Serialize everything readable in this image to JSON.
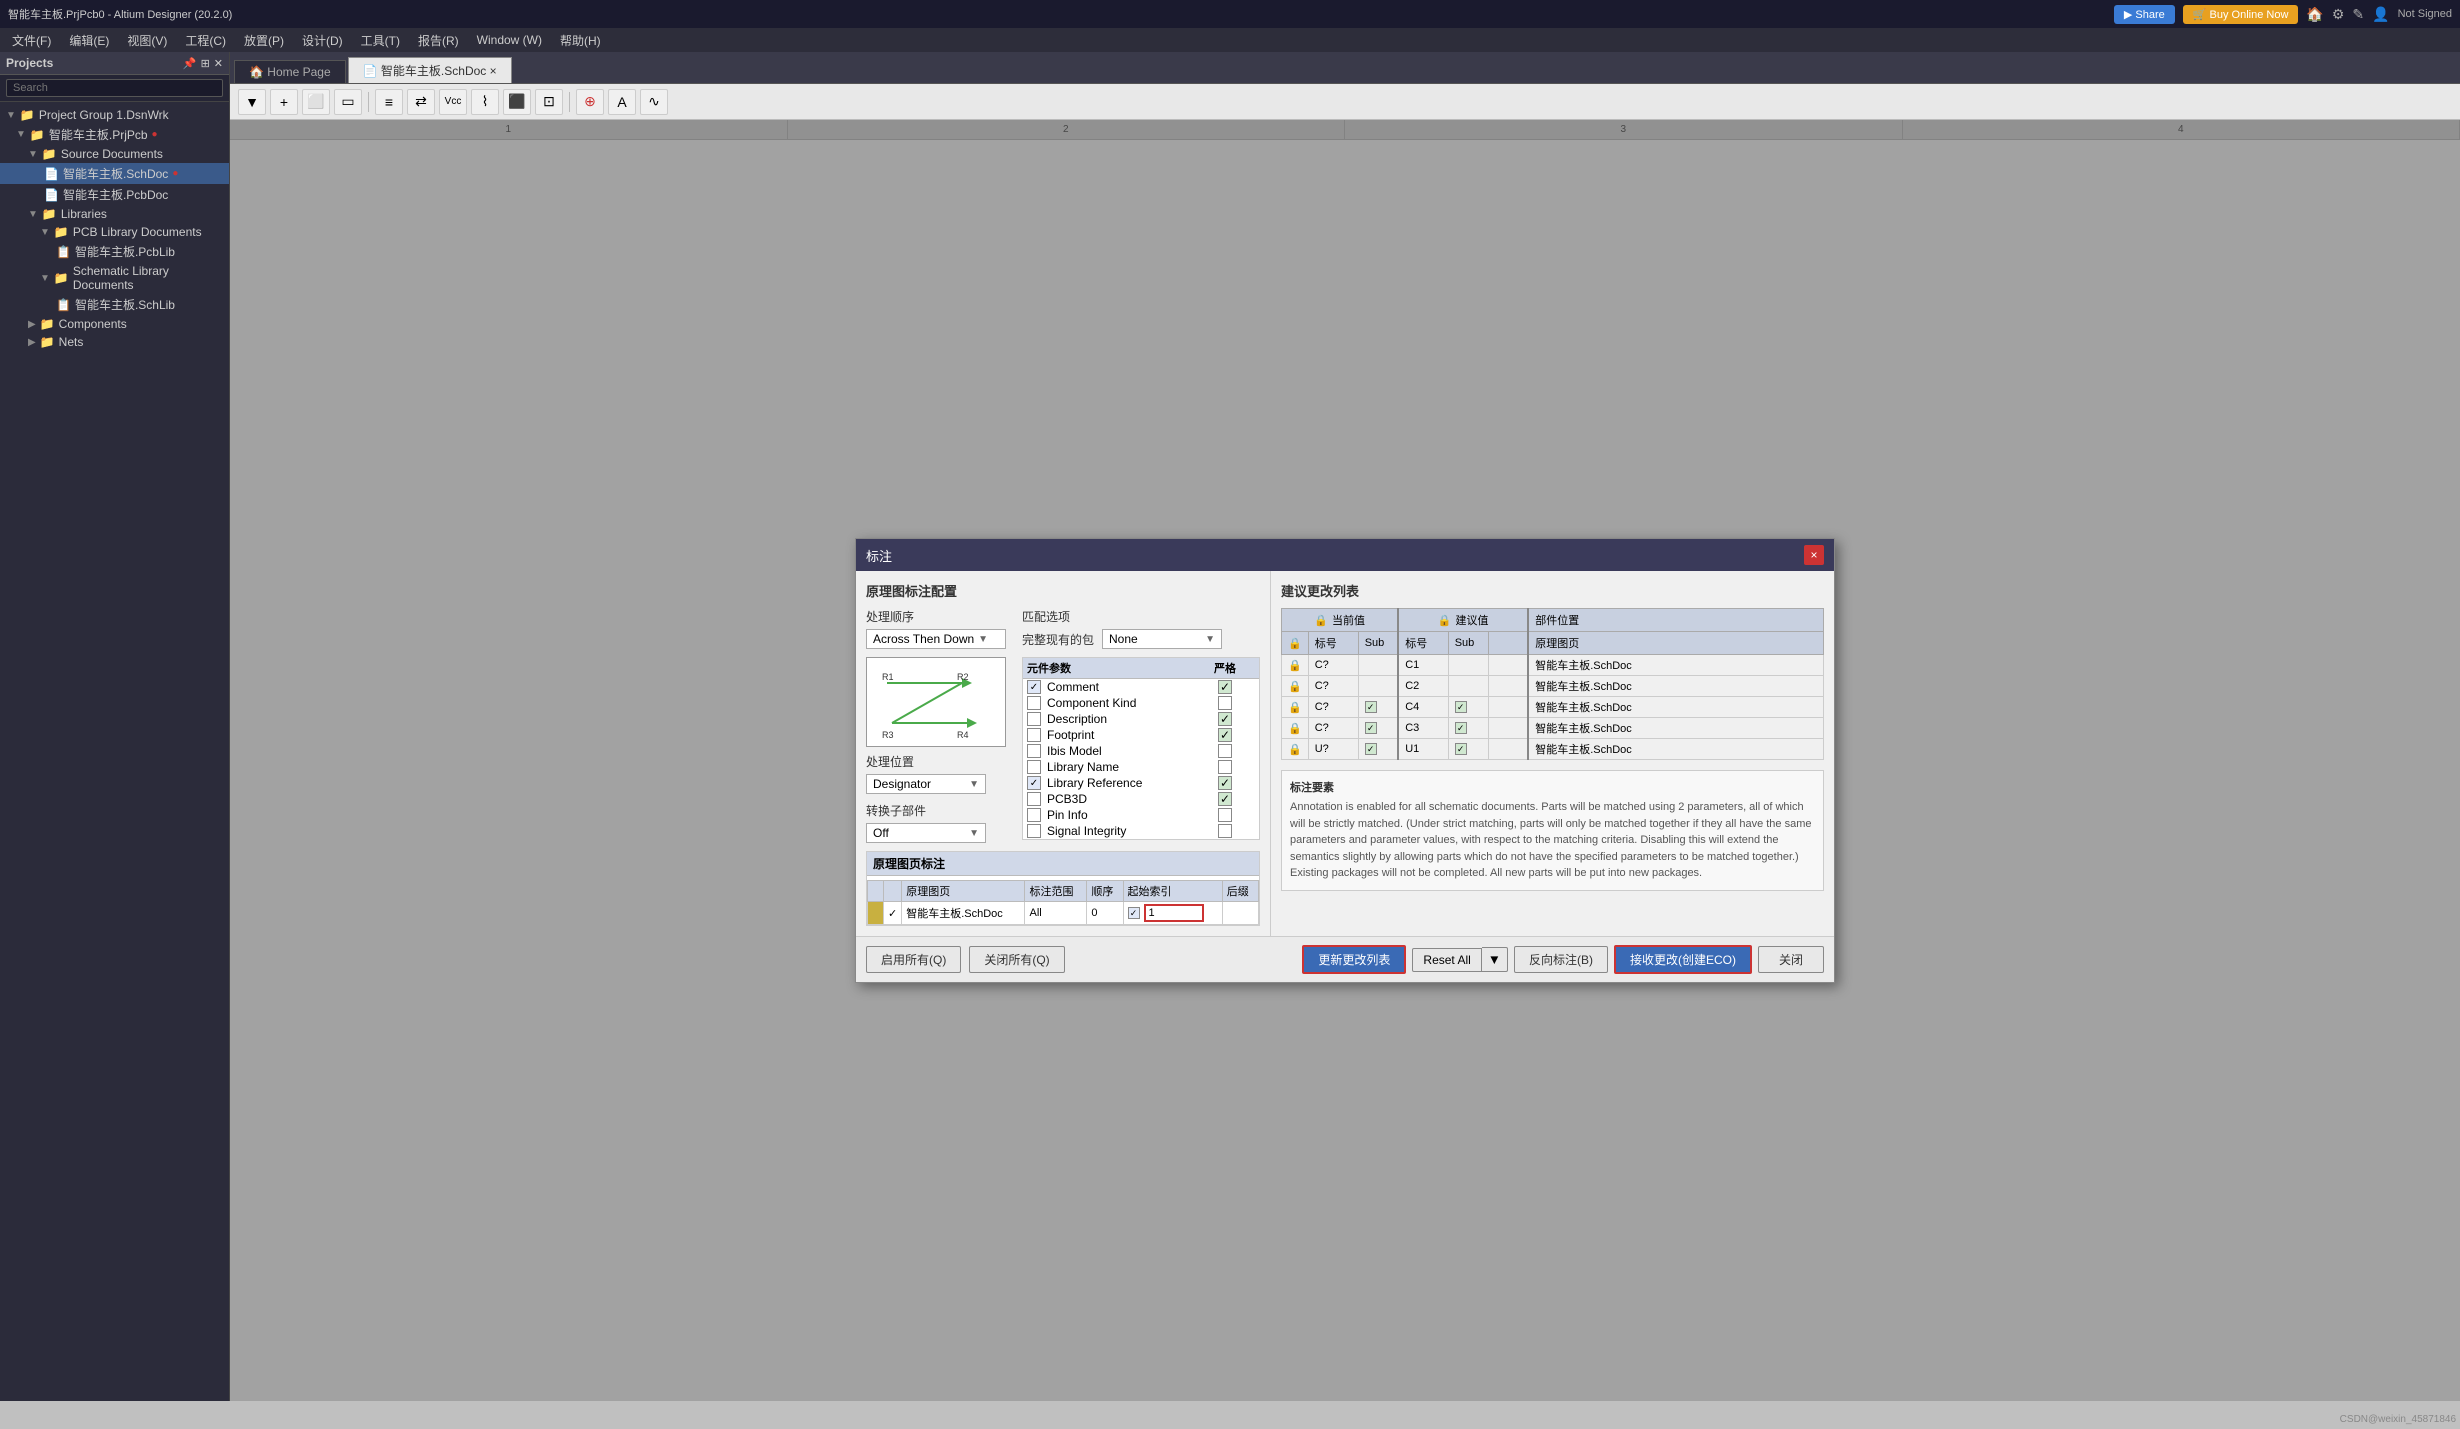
{
  "app": {
    "title": "智能车主板.PrjPcb0 - Altium Designer (20.2.0)",
    "menu_items": [
      "文件(F)",
      "编辑(E)",
      "视图(V)",
      "工程(C)",
      "放置(P)",
      "设计(D)",
      "工具(T)",
      "报告(R)",
      "Window (W)",
      "帮助(H)"
    ]
  },
  "topbar": {
    "share_label": "Share",
    "buy_label": "Buy Online Now",
    "not_signed": "Not Signed"
  },
  "tabs": [
    {
      "label": "Home Page",
      "active": false
    },
    {
      "label": "智能车主板.SchDoc",
      "active": true
    }
  ],
  "sidebar": {
    "title": "Projects",
    "search_placeholder": "Search",
    "tree": [
      {
        "label": "Project Group 1.DsnWrk",
        "level": 0,
        "type": "project-group"
      },
      {
        "label": "智能车主板.PrjPcb",
        "level": 0,
        "type": "project",
        "active": true
      },
      {
        "label": "Source Documents",
        "level": 1,
        "type": "folder"
      },
      {
        "label": "智能车主板.SchDoc",
        "level": 2,
        "type": "doc",
        "selected": true
      },
      {
        "label": "智能车主板.PcbDoc",
        "level": 2,
        "type": "doc"
      },
      {
        "label": "Libraries",
        "level": 1,
        "type": "folder"
      },
      {
        "label": "PCB Library Documents",
        "level": 2,
        "type": "folder"
      },
      {
        "label": "智能车主板.PcbLib",
        "level": 3,
        "type": "lib"
      },
      {
        "label": "Schematic Library Documents",
        "level": 2,
        "type": "folder"
      },
      {
        "label": "智能车主板.SchLib",
        "level": 3,
        "type": "lib"
      },
      {
        "label": "Components",
        "level": 1,
        "type": "folder"
      },
      {
        "label": "Nets",
        "level": 1,
        "type": "folder"
      }
    ]
  },
  "ruler": {
    "marks": [
      "1",
      "2",
      "3",
      "4"
    ]
  },
  "dialog": {
    "title": "标注",
    "close_label": "×",
    "left_panel": {
      "main_title": "原理图标注配置",
      "processing_order_title": "处理顺序",
      "processing_order_value": "Across Then Down",
      "processing_position_title": "处理位置",
      "processing_position_value": "Designator",
      "sub_parts_title": "转换子部件",
      "sub_parts_value": "Off",
      "matching_title": "匹配选项",
      "complete_packages_label": "完整现有的包",
      "complete_packages_value": "None",
      "params_header_name": "元件参数",
      "params_header_strict": "严格",
      "params": [
        {
          "name": "Comment",
          "checked": true,
          "strict": true
        },
        {
          "name": "Component Kind",
          "checked": false,
          "strict": false
        },
        {
          "name": "Description",
          "checked": false,
          "strict": true
        },
        {
          "name": "Footprint",
          "checked": false,
          "strict": true
        },
        {
          "name": "Ibis Model",
          "checked": false,
          "strict": false
        },
        {
          "name": "Library Name",
          "checked": false,
          "strict": false
        },
        {
          "name": "Library Reference",
          "checked": true,
          "strict": true
        },
        {
          "name": "PCB3D",
          "checked": false,
          "strict": true
        },
        {
          "name": "Pin Info",
          "checked": false,
          "strict": false
        },
        {
          "name": "Signal Integrity",
          "checked": false,
          "strict": false
        }
      ],
      "annot_table_title": "原理图页标注",
      "annot_columns": [
        "原理图页",
        "标注范围",
        "顺序",
        "起始索引",
        "后缀"
      ],
      "annot_rows": [
        {
          "enabled": true,
          "name": "智能车主板.SchDoc",
          "range": "All",
          "order": "0",
          "start_index": "1",
          "suffix": ""
        }
      ]
    },
    "right_panel": {
      "suggest_title": "建议更改列表",
      "current_col": "当前值",
      "suggest_col": "建议值",
      "part_location_col": "部件位置",
      "columns": {
        "lock": "🔒",
        "designator": "标号",
        "sub": "Sub",
        "suggest_designator": "标号",
        "suggest_sub": "Sub",
        "origin_sheet": "原理图页"
      },
      "rows": [
        {
          "lock": false,
          "designator": "C?",
          "sub": "",
          "suggest": "C1",
          "suggest_sub": "",
          "origin": "智能车主板.SchDoc"
        },
        {
          "lock": false,
          "designator": "C?",
          "sub": "",
          "suggest": "C2",
          "suggest_sub": "",
          "origin": "智能车主板.SchDoc"
        },
        {
          "lock": false,
          "designator": "C?",
          "sub": "",
          "suggest": "C4",
          "suggest_sub": true,
          "origin": "智能车主板.SchDoc"
        },
        {
          "lock": false,
          "designator": "C?",
          "sub": "",
          "suggest": "C3",
          "suggest_sub": true,
          "origin": "智能车主板.SchDoc"
        },
        {
          "lock": false,
          "designator": "U?",
          "sub": "",
          "suggest": "U1",
          "suggest_sub": true,
          "origin": "智能车主板.SchDoc"
        }
      ],
      "notes_title": "标注要素",
      "notes_text": "Annotation is enabled for all schematic documents. Parts will be matched using 2 parameters, all of which will be strictly matched. (Under strict matching, parts will only be matched together if they all have the same parameters and parameter values, with respect to the matching criteria. Disabling this will extend the semantics slightly by allowing parts which do not have the specified parameters to be matched together.) Existing packages will not be completed. All new parts will be put into new packages."
    },
    "footer": {
      "enable_all_label": "启用所有(Q)",
      "disable_all_label": "关闭所有(Q)",
      "update_list_label": "更新更改列表",
      "reset_all_label": "Reset All",
      "reverse_annotate_label": "反向标注(B)",
      "accept_changes_label": "接收更改(创建ECO)",
      "close_label": "关闭"
    }
  },
  "watermark": "CSDN@weixin_45871846"
}
